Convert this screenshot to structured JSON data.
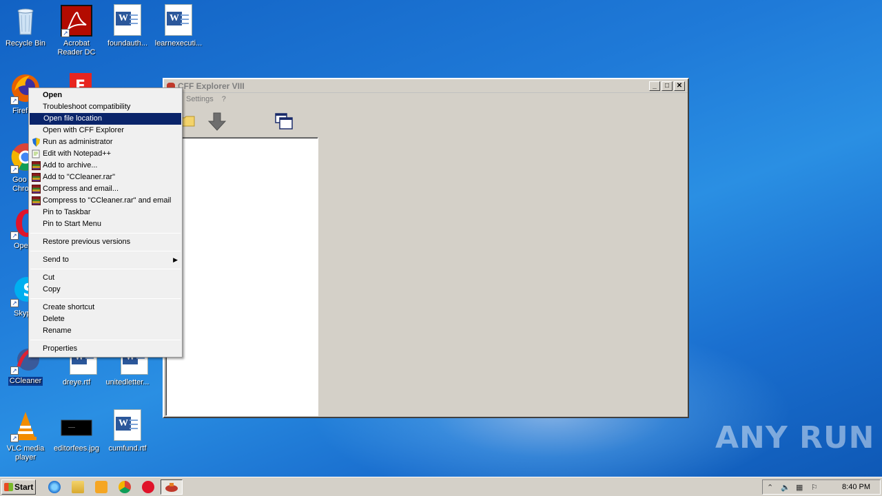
{
  "desktop": {
    "icons": [
      {
        "label": "Recycle Bin"
      },
      {
        "label": "Acrobat Reader DC"
      },
      {
        "label": "foundauth..."
      },
      {
        "label": "learnexecuti..."
      },
      {
        "label": "Firef"
      },
      {
        "label": "Goo Chro"
      },
      {
        "label": "Ope"
      },
      {
        "label": "Skyp"
      },
      {
        "label": "CCleaner"
      },
      {
        "label": "dreye.rtf"
      },
      {
        "label": "unitedletter..."
      },
      {
        "label": "VLC media player"
      },
      {
        "label": "editorfees.jpg"
      },
      {
        "label": "cumfund.rtf"
      }
    ]
  },
  "window": {
    "title": "CFF Explorer VIII",
    "menu": [
      "Settings",
      "?"
    ],
    "buttons": {
      "minimize": "_",
      "maximize": "□",
      "close": "✕"
    }
  },
  "context_menu": {
    "items": [
      {
        "label": "Open"
      },
      {
        "label": "Troubleshoot compatibility"
      },
      {
        "label": "Open file location"
      },
      {
        "label": "Open with CFF Explorer"
      },
      {
        "label": "Run as administrator"
      },
      {
        "label": "Edit with Notepad++"
      },
      {
        "label": "Add to archive..."
      },
      {
        "label": "Add to \"CCleaner.rar\""
      },
      {
        "label": "Compress and email..."
      },
      {
        "label": "Compress to \"CCleaner.rar\" and email"
      },
      {
        "label": "Pin to Taskbar"
      },
      {
        "label": "Pin to Start Menu"
      },
      {
        "label": "Restore previous versions"
      },
      {
        "label": "Send to"
      },
      {
        "label": "Cut"
      },
      {
        "label": "Copy"
      },
      {
        "label": "Create shortcut"
      },
      {
        "label": "Delete"
      },
      {
        "label": "Rename"
      },
      {
        "label": "Properties"
      }
    ]
  },
  "taskbar": {
    "start_label": "Start",
    "clock": "8:40 PM"
  },
  "watermark": "ANY RUN"
}
